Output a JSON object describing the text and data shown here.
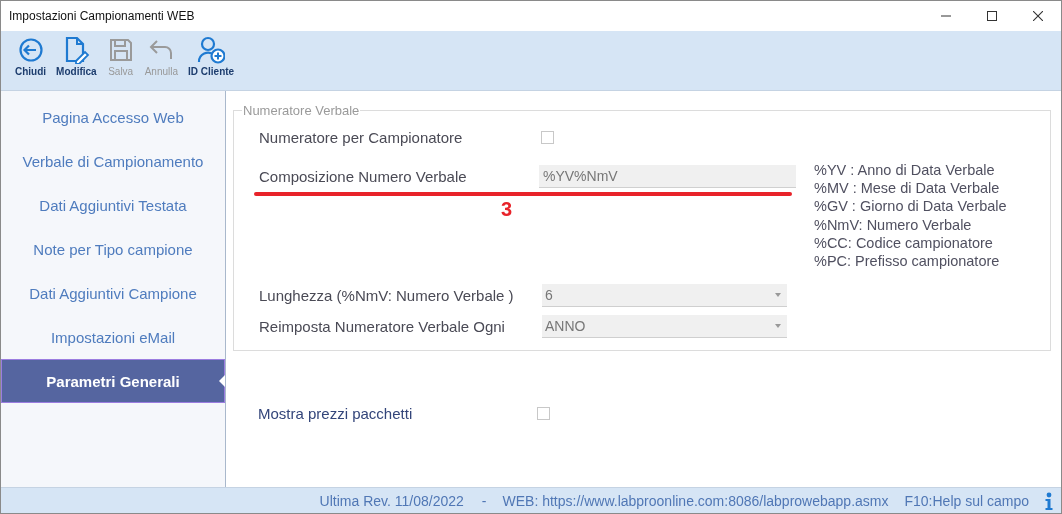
{
  "window": {
    "title": "Impostazioni Campionamenti WEB"
  },
  "toolbar": [
    {
      "kind": "close",
      "label": "Chiudi",
      "disabled": false
    },
    {
      "kind": "edit",
      "label": "Modifica",
      "disabled": false
    },
    {
      "kind": "save",
      "label": "Salva",
      "disabled": true
    },
    {
      "kind": "undo",
      "label": "Annulla",
      "disabled": true
    },
    {
      "kind": "user",
      "label": "ID Cliente",
      "disabled": false
    }
  ],
  "sidebar": {
    "items": [
      {
        "label": "Pagina Accesso Web",
        "selected": false
      },
      {
        "label": "Verbale di Campionamento",
        "selected": false
      },
      {
        "label": "Dati Aggiuntivi Testata",
        "selected": false
      },
      {
        "label": "Note per Tipo campione",
        "selected": false
      },
      {
        "label": "Dati Aggiuntivi Campione",
        "selected": false
      },
      {
        "label": "Impostazioni eMail",
        "selected": false
      },
      {
        "label": "Parametri Generali",
        "selected": true
      }
    ]
  },
  "group": {
    "title": "Numeratore Verbale",
    "numeratore": {
      "label": "Numeratore per Campionatore",
      "checked": false
    },
    "composizione": {
      "label": "Composizione Numero Verbale",
      "value": "%YV%NmV"
    },
    "legend": [
      "%YV : Anno di Data Verbale",
      "%MV : Mese di Data Verbale",
      "%GV : Giorno di Data Verbale",
      "%NmV: Numero Verbale",
      "%CC: Codice  campionatore",
      "%PC: Prefisso  campionatore"
    ],
    "dropdowns": [
      {
        "label": "Lunghezza (%NmV: Numero Verbale )",
        "value": "6"
      },
      {
        "label": "Reimposta Numeratore Verbale Ogni",
        "value": "ANNO"
      }
    ]
  },
  "annotation": {
    "label": "3"
  },
  "mostra_prezzi": {
    "label": "Mostra prezzi pacchetti",
    "checked": false
  },
  "status_bar": {
    "revision": "Ultima Rev. 11/08/2022",
    "separator": "-",
    "web": "WEB: https://www.labproonline.com:8086/labprowebapp.asmx",
    "help": "F10:Help sul campo"
  }
}
